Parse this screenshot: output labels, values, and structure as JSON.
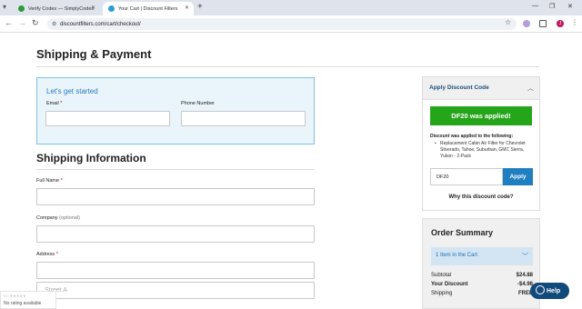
{
  "browser": {
    "tabs": [
      {
        "title": "Verify Codes — SimplyCodes",
        "favicon_color": "#2e9a3d"
      },
      {
        "title": "Your Cart | Discount Filters",
        "favicon_color": "#2a9fd6",
        "active": true
      }
    ],
    "url": "discountfilters.com/cart/checkout/",
    "profile_initial": "J"
  },
  "page": {
    "title": "Shipping & Payment"
  },
  "get_started": {
    "title": "Let's get started",
    "email_label": "Email",
    "email_required": "*",
    "phone_label": "Phone Number"
  },
  "shipping": {
    "title": "Shipping Information",
    "full_name_label": "Full Name",
    "required": "*",
    "company_label": "Company",
    "company_optional": "(optional)",
    "address_label": "Address",
    "address_placeholder": "Street A"
  },
  "discount": {
    "header": "Apply Discount Code",
    "applied_message": "DF20 was applied!",
    "applied_to_label": "Discount was applied to the following:",
    "applied_item": "Replacement Cabin Air Filter for Chevrolet Silverado, Tahoe, Suburban, GMC Sierra, Yukon - 2-Pack",
    "code_value": "DF20",
    "apply_label": "Apply",
    "why_label": "Why this discount code?"
  },
  "summary": {
    "title": "Order Summary",
    "cart_items_label": "1 Item in the Cart",
    "rows": [
      {
        "label": "Subtotal",
        "value": "$24.88"
      },
      {
        "label": "Your Discount",
        "value": "-$4.98"
      },
      {
        "label": "Shipping",
        "value": "FREE"
      }
    ]
  },
  "overlays": {
    "help_label": "Help",
    "rating_stars": "0.0 ★★★★★",
    "rating_text": "No rating available"
  },
  "colors": {
    "accent_blue": "#1f7fc0",
    "success_green": "#25a51a",
    "help_navy": "#134a7c"
  }
}
